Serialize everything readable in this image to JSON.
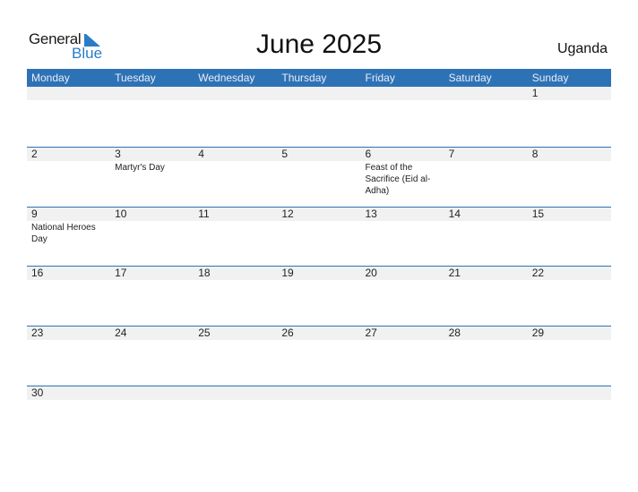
{
  "logo": {
    "word1": "General",
    "word2": "Blue"
  },
  "title": "June 2025",
  "country": "Uganda",
  "colors": {
    "accent": "#2e72b6",
    "day_strip": "#f1f1f1",
    "logo_blue": "#2a7cc7"
  },
  "weekdays": [
    "Monday",
    "Tuesday",
    "Wednesday",
    "Thursday",
    "Friday",
    "Saturday",
    "Sunday"
  ],
  "weeks": [
    {
      "days": [
        {
          "n": "",
          "h": ""
        },
        {
          "n": "",
          "h": ""
        },
        {
          "n": "",
          "h": ""
        },
        {
          "n": "",
          "h": ""
        },
        {
          "n": "",
          "h": ""
        },
        {
          "n": "",
          "h": ""
        },
        {
          "n": "1",
          "h": ""
        }
      ]
    },
    {
      "days": [
        {
          "n": "2",
          "h": ""
        },
        {
          "n": "3",
          "h": "Martyr's Day"
        },
        {
          "n": "4",
          "h": ""
        },
        {
          "n": "5",
          "h": ""
        },
        {
          "n": "6",
          "h": "Feast of the Sacrifice (Eid al-Adha)"
        },
        {
          "n": "7",
          "h": ""
        },
        {
          "n": "8",
          "h": ""
        }
      ]
    },
    {
      "days": [
        {
          "n": "9",
          "h": "National Heroes Day"
        },
        {
          "n": "10",
          "h": ""
        },
        {
          "n": "11",
          "h": ""
        },
        {
          "n": "12",
          "h": ""
        },
        {
          "n": "13",
          "h": ""
        },
        {
          "n": "14",
          "h": ""
        },
        {
          "n": "15",
          "h": ""
        }
      ]
    },
    {
      "days": [
        {
          "n": "16",
          "h": ""
        },
        {
          "n": "17",
          "h": ""
        },
        {
          "n": "18",
          "h": ""
        },
        {
          "n": "19",
          "h": ""
        },
        {
          "n": "20",
          "h": ""
        },
        {
          "n": "21",
          "h": ""
        },
        {
          "n": "22",
          "h": ""
        }
      ]
    },
    {
      "days": [
        {
          "n": "23",
          "h": ""
        },
        {
          "n": "24",
          "h": ""
        },
        {
          "n": "25",
          "h": ""
        },
        {
          "n": "26",
          "h": ""
        },
        {
          "n": "27",
          "h": ""
        },
        {
          "n": "28",
          "h": ""
        },
        {
          "n": "29",
          "h": ""
        }
      ]
    },
    {
      "days": [
        {
          "n": "30",
          "h": ""
        },
        {
          "n": "",
          "h": ""
        },
        {
          "n": "",
          "h": ""
        },
        {
          "n": "",
          "h": ""
        },
        {
          "n": "",
          "h": ""
        },
        {
          "n": "",
          "h": ""
        },
        {
          "n": "",
          "h": ""
        }
      ]
    }
  ]
}
